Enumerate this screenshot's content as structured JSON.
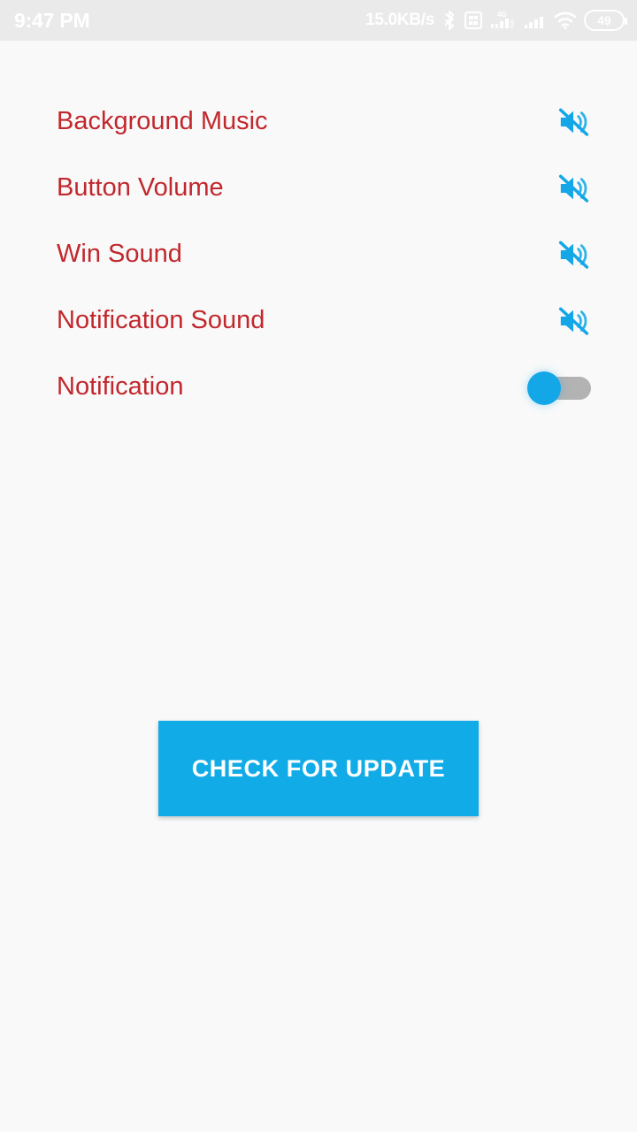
{
  "status_bar": {
    "clock": "9:47 PM",
    "network_speed": "15.0KB/s",
    "battery_level": "49",
    "icons": [
      "bluetooth-icon",
      "sim-card-icon",
      "signal-4g-icon",
      "signal-bars-icon",
      "wifi-icon",
      "battery-icon"
    ]
  },
  "settings": {
    "rows": [
      {
        "label": "Background Music",
        "control": "mute-icon",
        "icon": "volume-off-icon",
        "state": "muted"
      },
      {
        "label": "Button Volume",
        "control": "mute-icon",
        "icon": "volume-off-icon",
        "state": "muted"
      },
      {
        "label": "Win Sound",
        "control": "mute-icon",
        "icon": "volume-off-icon",
        "state": "muted"
      },
      {
        "label": "Notification Sound",
        "control": "mute-icon",
        "icon": "volume-off-icon",
        "state": "muted"
      },
      {
        "label": "Notification",
        "control": "toggle-switch",
        "icon": "toggle-icon",
        "state": "off"
      }
    ]
  },
  "actions": {
    "check_for_update_label": "CHECK FOR UPDATE"
  },
  "colors": {
    "background": "#f9f9f9",
    "status_bar_background": "#eaeaea",
    "label_red": "#c1282d",
    "accent_blue": "#11ace8",
    "toggle_track_gray": "#b3b3b3",
    "status_text_white": "#ffffff"
  }
}
